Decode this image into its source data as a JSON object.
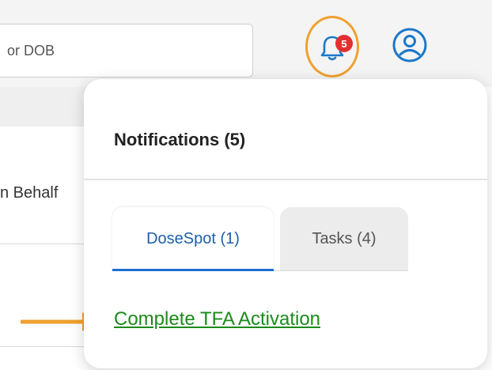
{
  "search": {
    "placeholder": "or DOB"
  },
  "notifications": {
    "badge_count": "5",
    "title": "Notifications (5)",
    "tabs": [
      {
        "label": "DoseSpot (1)",
        "active": true
      },
      {
        "label": "Tasks (4)",
        "active": false
      }
    ],
    "items": [
      {
        "label": "Complete TFA Activation"
      }
    ]
  },
  "background": {
    "behalf_text": "n Behalf"
  },
  "colors": {
    "accent_orange": "#f0a030",
    "badge_red": "#e23030",
    "link_green": "#1c8a1c",
    "tab_active_blue": "#1d6fd0"
  },
  "icons": {
    "bell": "bell-icon",
    "avatar": "user-circle-icon",
    "arrow": "arrow-right-icon"
  }
}
